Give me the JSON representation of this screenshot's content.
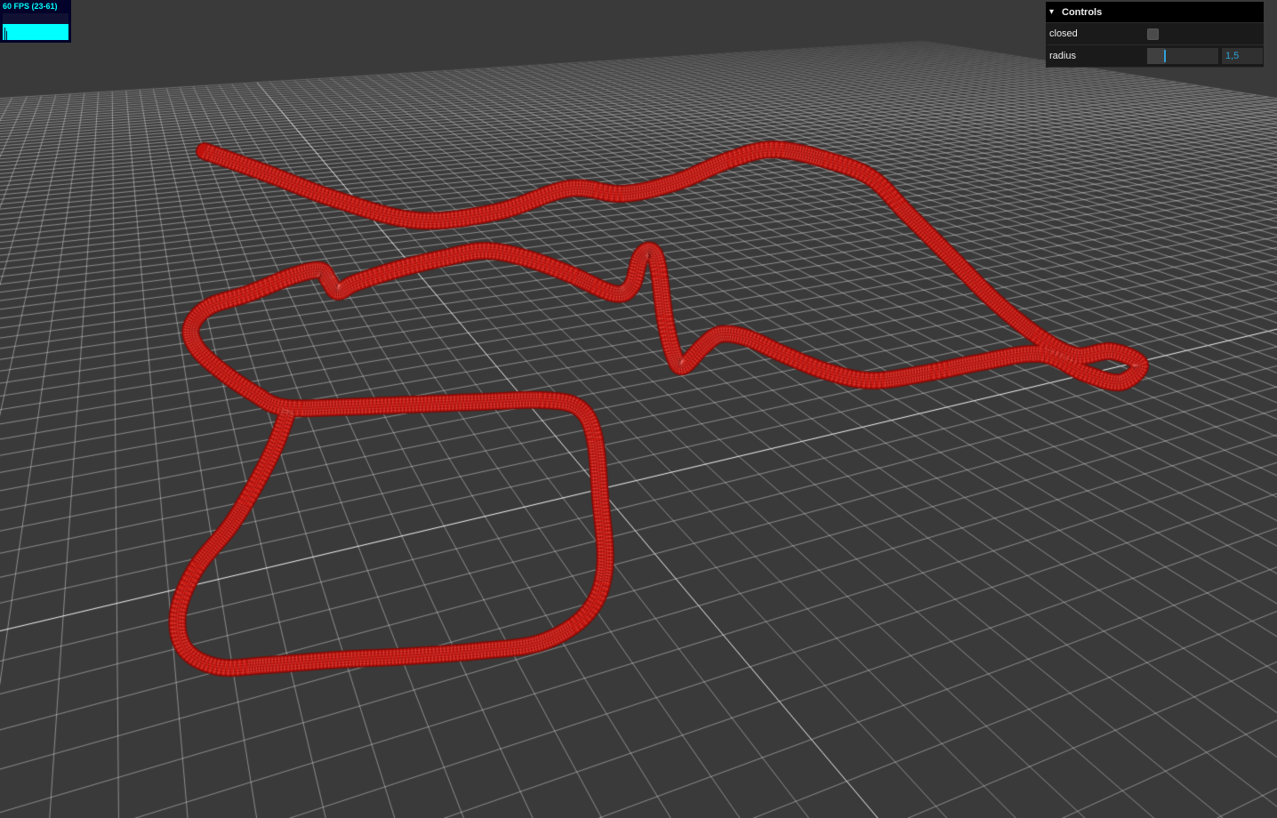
{
  "stats": {
    "fps_text": "60 FPS (23-61)",
    "fps_value": 60,
    "fps_min": 23,
    "fps_max": 61
  },
  "controls": {
    "title": "Controls",
    "closed_label": "closed",
    "closed_value": false,
    "radius_label": "radius",
    "radius_value": "1,5",
    "radius_fraction": 0.25
  },
  "scene": {
    "background_color": "#3a3a3a",
    "grid_color": "#ffffff",
    "tube_color": "#c0120c",
    "wire_highlight": "#ff6a5a",
    "tube_style": "wireframe"
  }
}
